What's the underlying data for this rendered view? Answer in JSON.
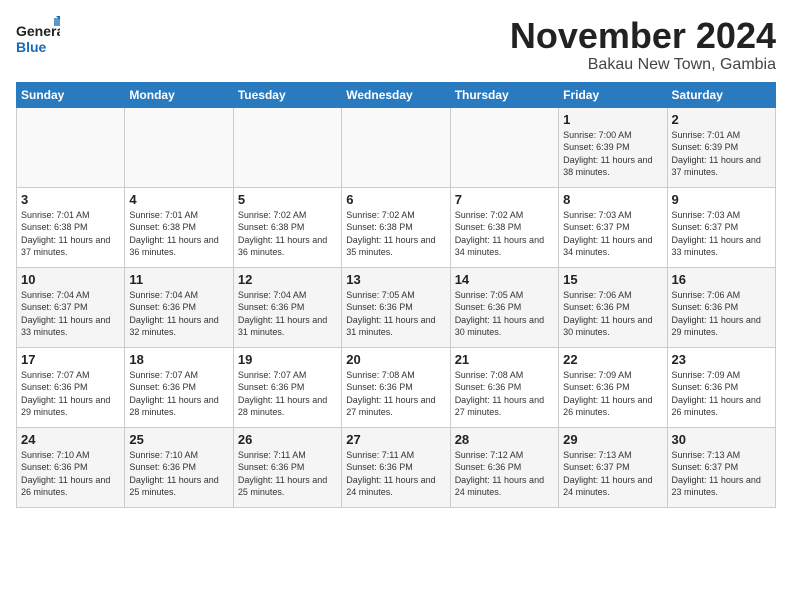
{
  "logo": {
    "text_general": "General",
    "text_blue": "Blue"
  },
  "header": {
    "month_title": "November 2024",
    "subtitle": "Bakau New Town, Gambia"
  },
  "weekdays": [
    "Sunday",
    "Monday",
    "Tuesday",
    "Wednesday",
    "Thursday",
    "Friday",
    "Saturday"
  ],
  "weeks": [
    [
      {
        "day": "",
        "info": ""
      },
      {
        "day": "",
        "info": ""
      },
      {
        "day": "",
        "info": ""
      },
      {
        "day": "",
        "info": ""
      },
      {
        "day": "",
        "info": ""
      },
      {
        "day": "1",
        "info": "Sunrise: 7:00 AM\nSunset: 6:39 PM\nDaylight: 11 hours and 38 minutes."
      },
      {
        "day": "2",
        "info": "Sunrise: 7:01 AM\nSunset: 6:39 PM\nDaylight: 11 hours and 37 minutes."
      }
    ],
    [
      {
        "day": "3",
        "info": "Sunrise: 7:01 AM\nSunset: 6:38 PM\nDaylight: 11 hours and 37 minutes."
      },
      {
        "day": "4",
        "info": "Sunrise: 7:01 AM\nSunset: 6:38 PM\nDaylight: 11 hours and 36 minutes."
      },
      {
        "day": "5",
        "info": "Sunrise: 7:02 AM\nSunset: 6:38 PM\nDaylight: 11 hours and 36 minutes."
      },
      {
        "day": "6",
        "info": "Sunrise: 7:02 AM\nSunset: 6:38 PM\nDaylight: 11 hours and 35 minutes."
      },
      {
        "day": "7",
        "info": "Sunrise: 7:02 AM\nSunset: 6:38 PM\nDaylight: 11 hours and 34 minutes."
      },
      {
        "day": "8",
        "info": "Sunrise: 7:03 AM\nSunset: 6:37 PM\nDaylight: 11 hours and 34 minutes."
      },
      {
        "day": "9",
        "info": "Sunrise: 7:03 AM\nSunset: 6:37 PM\nDaylight: 11 hours and 33 minutes."
      }
    ],
    [
      {
        "day": "10",
        "info": "Sunrise: 7:04 AM\nSunset: 6:37 PM\nDaylight: 11 hours and 33 minutes."
      },
      {
        "day": "11",
        "info": "Sunrise: 7:04 AM\nSunset: 6:36 PM\nDaylight: 11 hours and 32 minutes."
      },
      {
        "day": "12",
        "info": "Sunrise: 7:04 AM\nSunset: 6:36 PM\nDaylight: 11 hours and 31 minutes."
      },
      {
        "day": "13",
        "info": "Sunrise: 7:05 AM\nSunset: 6:36 PM\nDaylight: 11 hours and 31 minutes."
      },
      {
        "day": "14",
        "info": "Sunrise: 7:05 AM\nSunset: 6:36 PM\nDaylight: 11 hours and 30 minutes."
      },
      {
        "day": "15",
        "info": "Sunrise: 7:06 AM\nSunset: 6:36 PM\nDaylight: 11 hours and 30 minutes."
      },
      {
        "day": "16",
        "info": "Sunrise: 7:06 AM\nSunset: 6:36 PM\nDaylight: 11 hours and 29 minutes."
      }
    ],
    [
      {
        "day": "17",
        "info": "Sunrise: 7:07 AM\nSunset: 6:36 PM\nDaylight: 11 hours and 29 minutes."
      },
      {
        "day": "18",
        "info": "Sunrise: 7:07 AM\nSunset: 6:36 PM\nDaylight: 11 hours and 28 minutes."
      },
      {
        "day": "19",
        "info": "Sunrise: 7:07 AM\nSunset: 6:36 PM\nDaylight: 11 hours and 28 minutes."
      },
      {
        "day": "20",
        "info": "Sunrise: 7:08 AM\nSunset: 6:36 PM\nDaylight: 11 hours and 27 minutes."
      },
      {
        "day": "21",
        "info": "Sunrise: 7:08 AM\nSunset: 6:36 PM\nDaylight: 11 hours and 27 minutes."
      },
      {
        "day": "22",
        "info": "Sunrise: 7:09 AM\nSunset: 6:36 PM\nDaylight: 11 hours and 26 minutes."
      },
      {
        "day": "23",
        "info": "Sunrise: 7:09 AM\nSunset: 6:36 PM\nDaylight: 11 hours and 26 minutes."
      }
    ],
    [
      {
        "day": "24",
        "info": "Sunrise: 7:10 AM\nSunset: 6:36 PM\nDaylight: 11 hours and 26 minutes."
      },
      {
        "day": "25",
        "info": "Sunrise: 7:10 AM\nSunset: 6:36 PM\nDaylight: 11 hours and 25 minutes."
      },
      {
        "day": "26",
        "info": "Sunrise: 7:11 AM\nSunset: 6:36 PM\nDaylight: 11 hours and 25 minutes."
      },
      {
        "day": "27",
        "info": "Sunrise: 7:11 AM\nSunset: 6:36 PM\nDaylight: 11 hours and 24 minutes."
      },
      {
        "day": "28",
        "info": "Sunrise: 7:12 AM\nSunset: 6:36 PM\nDaylight: 11 hours and 24 minutes."
      },
      {
        "day": "29",
        "info": "Sunrise: 7:13 AM\nSunset: 6:37 PM\nDaylight: 11 hours and 24 minutes."
      },
      {
        "day": "30",
        "info": "Sunrise: 7:13 AM\nSunset: 6:37 PM\nDaylight: 11 hours and 23 minutes."
      }
    ]
  ]
}
